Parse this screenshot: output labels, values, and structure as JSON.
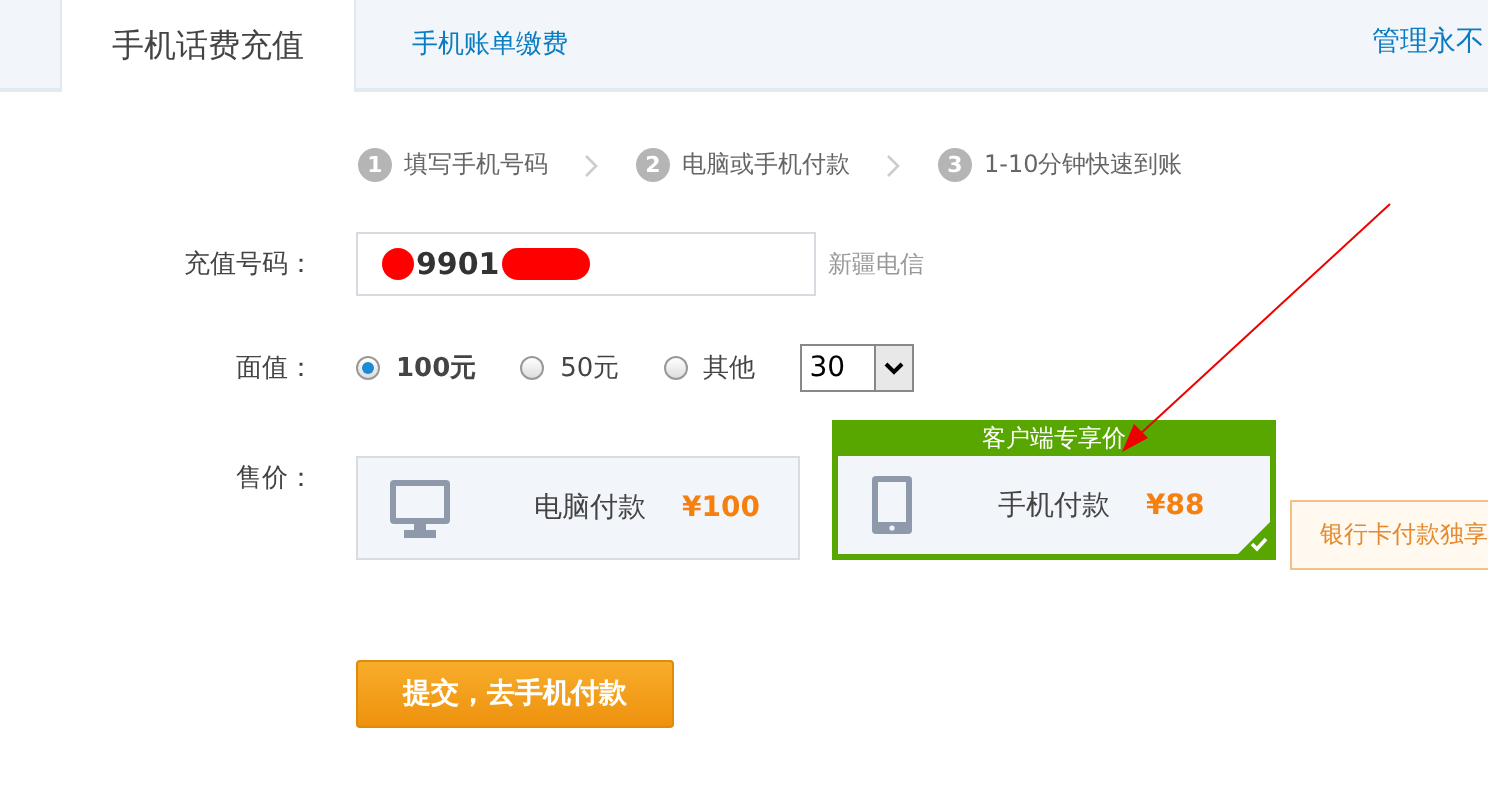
{
  "tabs": [
    {
      "label": "手机话费充值",
      "selected": true
    },
    {
      "label": "手机账单缴费",
      "selected": false
    }
  ],
  "header_link": "管理永不",
  "steps": [
    {
      "number": "1",
      "label": "填写手机号码"
    },
    {
      "number": "2",
      "label": "电脑或手机付款"
    },
    {
      "number": "3",
      "label": "1-10分钟快速到账"
    }
  ],
  "phone": {
    "label": "充值号码：",
    "value": "9901",
    "carrier": "新疆电信"
  },
  "amount": {
    "label": "面值：",
    "options": [
      {
        "label": "100元",
        "selected": true
      },
      {
        "label": "50元",
        "selected": false
      },
      {
        "label": "其他",
        "selected": false
      }
    ],
    "select_value": "30"
  },
  "price": {
    "label": "售价：",
    "options": [
      {
        "kind": "desktop",
        "label": "电脑付款",
        "price": "¥100",
        "selected": false
      },
      {
        "kind": "phone",
        "label": "手机付款",
        "price": "¥88",
        "selected": true,
        "badge": "客户端专享价"
      }
    ],
    "tip": "银行卡付款独享"
  },
  "submit": "提交，去手机付款"
}
